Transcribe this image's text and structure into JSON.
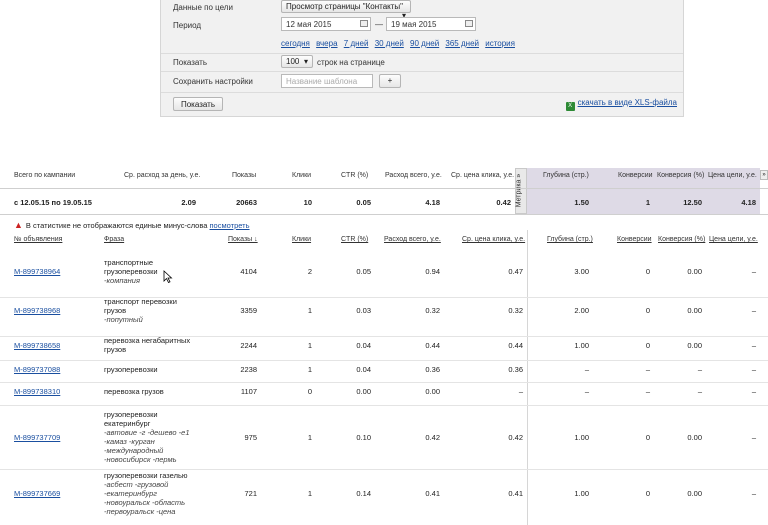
{
  "filters": {
    "goal_label": "Данные по цели",
    "goal_value": "Просмотр страницы \"Контакты\"",
    "period_label": "Период",
    "date_from": "12 мая 2015",
    "date_dash": "—",
    "date_to": "19 мая 2015",
    "periods": [
      "сегодня",
      "вчера",
      "7 дней",
      "30 дней",
      "90 дней",
      "365 дней",
      "история"
    ],
    "show_label": "Показать",
    "rows_value": "100",
    "rows_suffix": "строк на странице",
    "save_label": "Сохранить настройки",
    "template_placeholder": "Название шаблона",
    "plus": "+",
    "show_button": "Показать",
    "xls_link": "скачать в виде XLS-файла"
  },
  "summary": {
    "headers": {
      "campaign": "Всего по кампании",
      "daily": "Ср. расход за день, у.е.",
      "shows": "Показы",
      "clicks": "Клики",
      "ctr": "CTR (%)",
      "total": "Расход всего, у.е.",
      "cpc": "Ср. цена клика, у.е.",
      "depth": "Глубина (стр.)",
      "conv": "Конверсии",
      "conv_pct": "Конверсия (%)",
      "goal_price": "Цена цели, у.е."
    },
    "metrika": "Метрика »",
    "more": "»",
    "values": {
      "period": "с 12.05.15 по 19.05.15",
      "daily": "2.09",
      "shows": "20663",
      "clicks": "10",
      "ctr": "0.05",
      "total": "4.18",
      "cpc": "0.42",
      "depth": "1.50",
      "conv": "1",
      "conv_pct": "12.50",
      "goal_price": "4.18"
    }
  },
  "warning": {
    "text": "В статистике не отображаются единые минус-слова",
    "link": "посмотреть"
  },
  "columns": {
    "id": "№ объявления",
    "phrase": "Фраза",
    "shows": "Показы ↓",
    "clicks": "Клики",
    "ctr": "CTR (%)",
    "total": "Расход всего, у.е.",
    "cpc": "Ср. цена клика, у.е.",
    "depth": "Глубина (стр.)",
    "conv": "Конверсии",
    "conv_pct": "Конверсия (%)",
    "goal_price": "Цена цели, у.е."
  },
  "rows": [
    {
      "id": "M-899738964",
      "phrase": [
        "транспортные",
        "грузоперевозки"
      ],
      "minus": [
        "-компания"
      ],
      "shows": "4104",
      "clicks": "2",
      "ctr": "0.05",
      "total": "0.94",
      "cpc": "0.47",
      "depth": "3.00",
      "conv": "0",
      "conv_pct": "0.00",
      "goal_price": "–"
    },
    {
      "id": "M-899738968",
      "phrase": [
        "транспорт перевозки",
        "грузов"
      ],
      "minus": [
        "-попутный"
      ],
      "shows": "3359",
      "clicks": "1",
      "ctr": "0.03",
      "total": "0.32",
      "cpc": "0.32",
      "depth": "2.00",
      "conv": "0",
      "conv_pct": "0.00",
      "goal_price": "–"
    },
    {
      "id": "M-899738658",
      "phrase": [
        "перевозка негабаритных",
        "грузов"
      ],
      "minus": [],
      "shows": "2244",
      "clicks": "1",
      "ctr": "0.04",
      "total": "0.44",
      "cpc": "0.44",
      "depth": "1.00",
      "conv": "0",
      "conv_pct": "0.00",
      "goal_price": "–"
    },
    {
      "id": "M-899737088",
      "phrase": [
        "грузоперевозки"
      ],
      "minus": [],
      "shows": "2238",
      "clicks": "1",
      "ctr": "0.04",
      "total": "0.36",
      "cpc": "0.36",
      "depth": "–",
      "conv": "–",
      "conv_pct": "–",
      "goal_price": "–"
    },
    {
      "id": "M-899738310",
      "phrase": [
        "перевозка грузов"
      ],
      "minus": [],
      "shows": "1107",
      "clicks": "0",
      "ctr": "0.00",
      "total": "0.00",
      "cpc": "–",
      "depth": "–",
      "conv": "–",
      "conv_pct": "–",
      "goal_price": "–"
    },
    {
      "id": "M-899737709",
      "phrase": [
        "грузоперевозки",
        "екатеринбург"
      ],
      "minus": [
        "-автовие -г -дешево -е1",
        "-камаз -курган",
        "-международный",
        "-новосибирск -пермь"
      ],
      "shows": "975",
      "clicks": "1",
      "ctr": "0.10",
      "total": "0.42",
      "cpc": "0.42",
      "depth": "1.00",
      "conv": "0",
      "conv_pct": "0.00",
      "goal_price": "–"
    },
    {
      "id": "M-899737669",
      "phrase": [
        "грузоперевозки газелью"
      ],
      "minus": [
        "-асбест -грузовой",
        "-екатеринбург",
        "-новоуральск -область",
        "-первоуральск -цена"
      ],
      "shows": "721",
      "clicks": "1",
      "ctr": "0.14",
      "total": "0.41",
      "cpc": "0.41",
      "depth": "1.00",
      "conv": "0",
      "conv_pct": "0.00",
      "goal_price": "–"
    }
  ]
}
